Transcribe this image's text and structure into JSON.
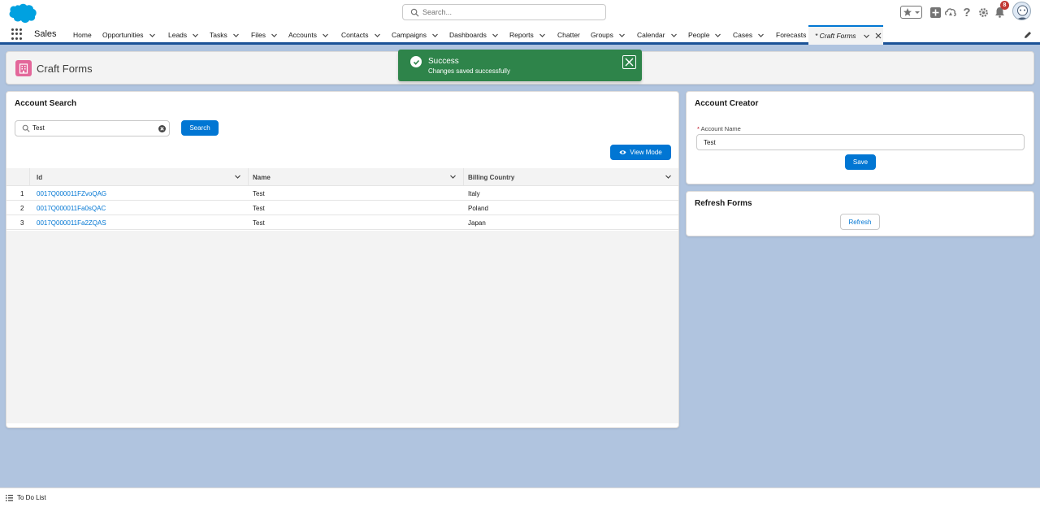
{
  "header": {
    "search_placeholder": "Search...",
    "notification_count": "8"
  },
  "nav": {
    "app_name": "Sales",
    "items": [
      {
        "label": "Home",
        "has_menu": false
      },
      {
        "label": "Opportunities",
        "has_menu": true
      },
      {
        "label": "Leads",
        "has_menu": true
      },
      {
        "label": "Tasks",
        "has_menu": true
      },
      {
        "label": "Files",
        "has_menu": true
      },
      {
        "label": "Accounts",
        "has_menu": true
      },
      {
        "label": "Contacts",
        "has_menu": true
      },
      {
        "label": "Campaigns",
        "has_menu": true
      },
      {
        "label": "Dashboards",
        "has_menu": true
      },
      {
        "label": "Reports",
        "has_menu": true
      },
      {
        "label": "Chatter",
        "has_menu": false
      },
      {
        "label": "Groups",
        "has_menu": true
      },
      {
        "label": "Calendar",
        "has_menu": true
      },
      {
        "label": "People",
        "has_menu": true
      },
      {
        "label": "Cases",
        "has_menu": true
      },
      {
        "label": "Forecasts",
        "has_menu": false
      }
    ],
    "active_tab": "* Craft Forms"
  },
  "page_header": {
    "title": "Craft Forms"
  },
  "toast": {
    "title": "Success",
    "message": "Changes saved successfully",
    "color": "#2e844a"
  },
  "account_search": {
    "title": "Account Search",
    "search_value": "Test",
    "search_button": "Search",
    "view_mode_button": "View Mode",
    "columns": [
      "Id",
      "Name",
      "Billing Country"
    ],
    "rows": [
      {
        "num": "1",
        "id": "0017Q000011FZvoQAG",
        "name": "Test",
        "country": "Italy"
      },
      {
        "num": "2",
        "id": "0017Q000011Fa0sQAC",
        "name": "Test",
        "country": "Poland"
      },
      {
        "num": "3",
        "id": "0017Q000011Fa2ZQAS",
        "name": "Test",
        "country": "Japan"
      }
    ]
  },
  "account_creator": {
    "title": "Account Creator",
    "field_label": "Account Name",
    "required_mark": "*",
    "field_value": "Test",
    "save_button": "Save"
  },
  "refresh_forms": {
    "title": "Refresh Forms",
    "refresh_button": "Refresh"
  },
  "utility_bar": {
    "todo_label": "To Do List"
  },
  "colors": {
    "brand": "#0176d3",
    "nav_border": "#1b5297",
    "background": "#b0c4df",
    "page_icon": "#e3679a"
  }
}
